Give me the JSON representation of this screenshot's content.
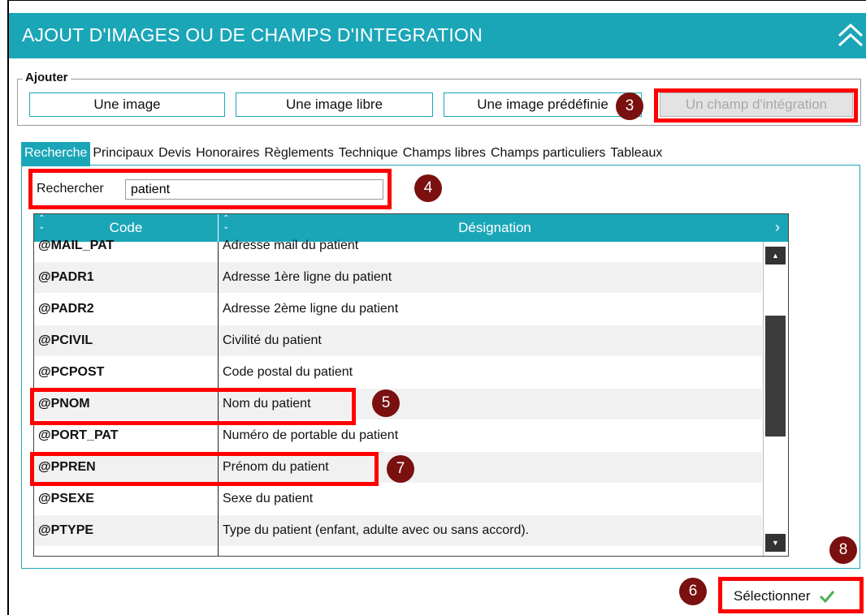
{
  "window": {
    "title": "AJOUT D'IMAGES OU DE CHAMPS D'INTEGRATION"
  },
  "icons": {
    "collapse": "double-chevron-up-icon",
    "sort": "sort-arrows-icon",
    "check": "checkmark-icon"
  },
  "add_group": {
    "label": "Ajouter",
    "buttons": [
      {
        "label": "Une image"
      },
      {
        "label": "Une image libre"
      },
      {
        "label": "Une image prédéfinie"
      },
      {
        "label": "Un champ d'intégration",
        "state": "disabled"
      }
    ]
  },
  "tabs": [
    {
      "label": "Recherche",
      "active": true
    },
    {
      "label": "Principaux"
    },
    {
      "label": "Devis"
    },
    {
      "label": "Honoraires"
    },
    {
      "label": "Règlements"
    },
    {
      "label": "Technique"
    },
    {
      "label": "Champs libres"
    },
    {
      "label": "Champs particuliers"
    },
    {
      "label": "Tableaux"
    }
  ],
  "search": {
    "label": "Rechercher",
    "value": "patient"
  },
  "table": {
    "columns": [
      "Code",
      "Désignation"
    ],
    "rows": [
      {
        "code": "@MAIL_PAT",
        "designation": "Adresse mail du patient"
      },
      {
        "code": "@PADR1",
        "designation": "Adresse 1ère ligne du patient"
      },
      {
        "code": "@PADR2",
        "designation": "Adresse 2ème ligne du patient"
      },
      {
        "code": "@PCIVIL",
        "designation": "Civilité du patient"
      },
      {
        "code": "@PCPOST",
        "designation": "Code postal du patient"
      },
      {
        "code": "@PNOM",
        "designation": "Nom du patient"
      },
      {
        "code": "@PORT_PAT",
        "designation": "Numéro de portable du patient"
      },
      {
        "code": "@PPREN",
        "designation": "Prénom du patient"
      },
      {
        "code": "@PSEXE",
        "designation": "Sexe du patient"
      },
      {
        "code": "@PTYPE",
        "designation": "Type du patient (enfant, adulte avec ou sans accord)."
      }
    ]
  },
  "select_button": {
    "label": "Sélectionner"
  },
  "annotations": {
    "color": "#ff0000",
    "badge_color": "#7a1010",
    "badges": [
      "3",
      "4",
      "5",
      "7",
      "8",
      "6"
    ]
  },
  "colors": {
    "accent": "#1ba6b8"
  }
}
